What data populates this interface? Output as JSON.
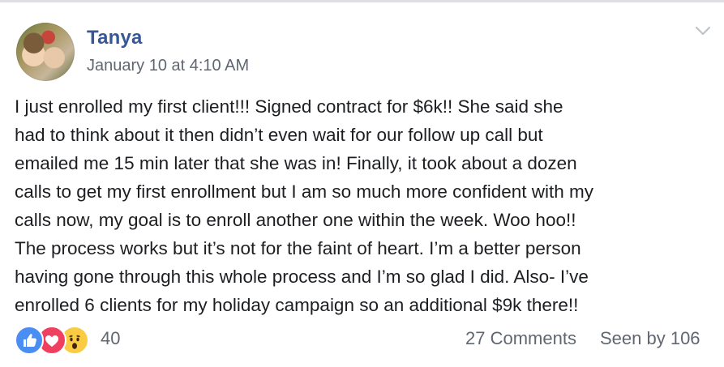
{
  "post": {
    "author": "Tanya",
    "timestamp": "January 10 at 4:10 AM",
    "lines": [
      "I just enrolled my first client!!! Signed contract for $6k!! She said she",
      "had to think about it then didn’t even wait for our follow up call but",
      "emailed me 15 min later that she was in! Finally, it took about a dozen",
      "calls to get my first enrollment but I am so much more confident with my",
      "calls now, my goal is to enroll another one within the week. Woo hoo!!",
      "The process works but it’s not for the faint of heart. I’m a better person",
      "having gone through this whole process and I’m so glad I did. Also- I’ve",
      "enrolled 6 clients for my holiday campaign so an additional $9k there!!"
    ]
  },
  "footer": {
    "reaction_count": "40",
    "comments_label": "27 Comments",
    "seen_label": "Seen by 106",
    "reaction_icons": [
      "like-icon",
      "love-icon",
      "wow-icon"
    ]
  },
  "colors": {
    "author": "#365899",
    "meta": "#616770",
    "like": "#4a8df3",
    "love": "#f0405f",
    "wow": "#f9cc44"
  }
}
